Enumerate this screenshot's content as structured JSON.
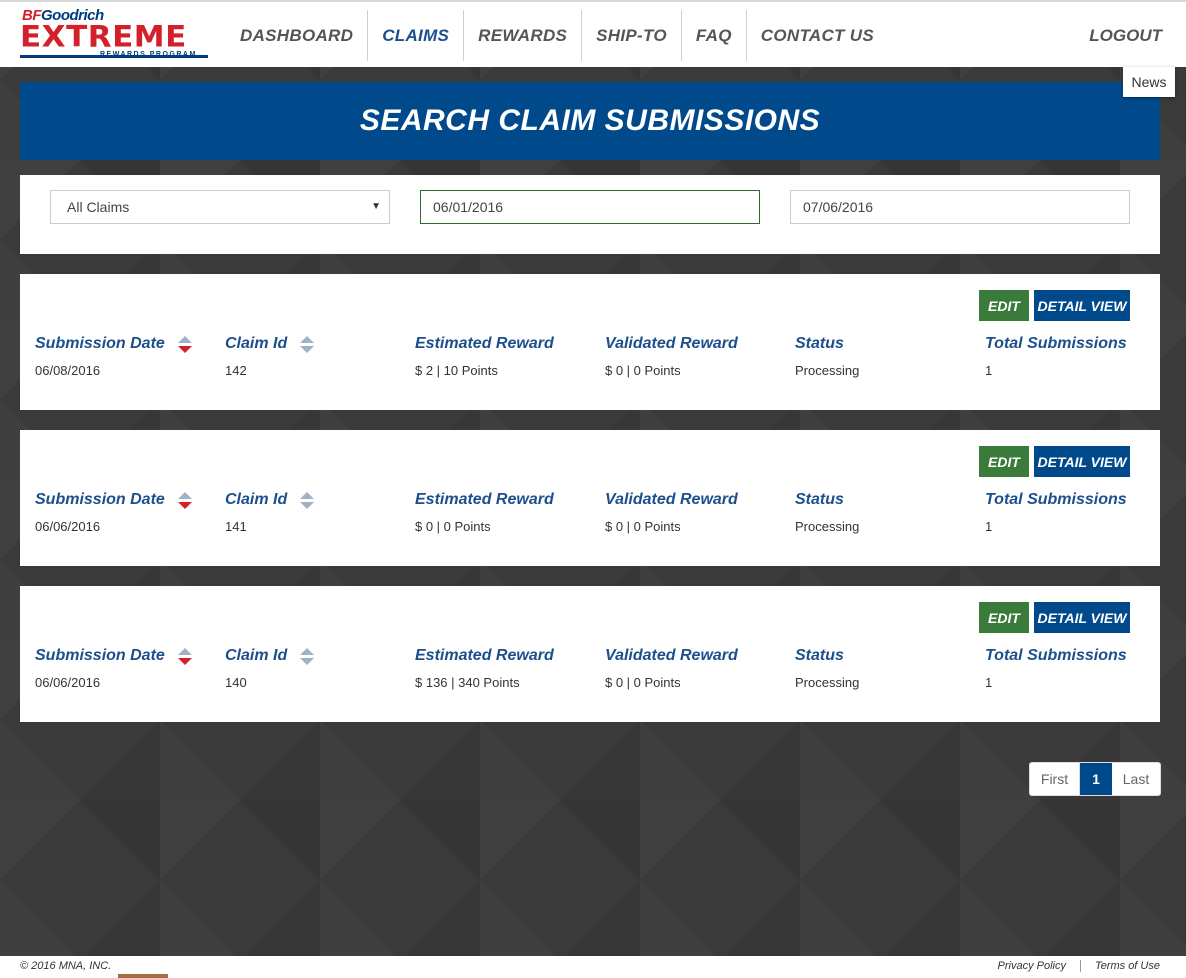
{
  "header": {
    "logo": {
      "brand_prefix": "BF",
      "brand_suffix": "Goodrich",
      "name": "EXTREME",
      "tagline": "REWARDS PROGRAM"
    },
    "nav": [
      {
        "label": "DASHBOARD"
      },
      {
        "label": "CLAIMS"
      },
      {
        "label": "REWARDS"
      },
      {
        "label": "SHIP-TO"
      },
      {
        "label": "FAQ"
      },
      {
        "label": "CONTACT US"
      }
    ],
    "active_nav": "CLAIMS",
    "logout_label": "LOGOUT",
    "news_label": "News"
  },
  "page_title": "SEARCH CLAIM SUBMISSIONS",
  "filters": {
    "claim_type": "All Claims",
    "start_date": "06/01/2016",
    "end_date": "07/06/2016"
  },
  "columns": {
    "submission_date": "Submission Date",
    "claim_id": "Claim Id",
    "estimated_reward": "Estimated Reward",
    "validated_reward": "Validated Reward",
    "status": "Status",
    "total_submissions": "Total Submissions"
  },
  "buttons": {
    "edit": "EDIT",
    "detail": "DETAIL VIEW"
  },
  "claims": [
    {
      "submission_date": "06/08/2016",
      "claim_id": "142",
      "estimated_reward": "$ 2 | 10 Points",
      "validated_reward": "$ 0 | 0 Points",
      "status": "Processing",
      "total_submissions": "1"
    },
    {
      "submission_date": "06/06/2016",
      "claim_id": "141",
      "estimated_reward": "$ 0 | 0 Points",
      "validated_reward": "$ 0 | 0 Points",
      "status": "Processing",
      "total_submissions": "1"
    },
    {
      "submission_date": "06/06/2016",
      "claim_id": "140",
      "estimated_reward": "$ 136 | 340 Points",
      "validated_reward": "$ 0 | 0 Points",
      "status": "Processing",
      "total_submissions": "1"
    }
  ],
  "pagination": {
    "first": "First",
    "current": "1",
    "last": "Last"
  },
  "footer": {
    "copyright": "© 2016 MNA, INC.",
    "privacy": "Privacy Policy",
    "terms": "Terms of Use"
  },
  "colors": {
    "brand_blue": "#004a8c",
    "brand_red": "#d3202b",
    "edit_green": "#3a7a3a",
    "nav_active": "#1b4f8f"
  }
}
